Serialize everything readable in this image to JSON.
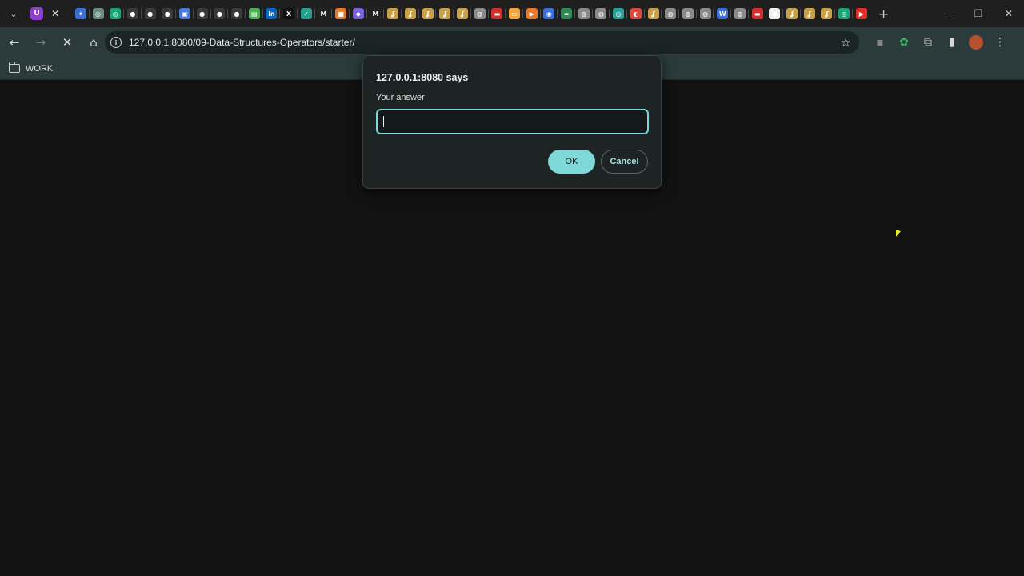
{
  "browser": {
    "url": "127.0.0.1:8080/09-Data-Structures-Operators/starter/",
    "bookmark_folder": "WORK",
    "pinned_tabs": [
      {
        "icon": "gemini-icon",
        "color": "#3b6fd8",
        "glyph": "✦"
      },
      {
        "icon": "chatgpt-icon",
        "color": "#6b8b82",
        "glyph": "◎"
      },
      {
        "icon": "chatgpt-icon",
        "color": "#19a37a",
        "glyph": "◎"
      },
      {
        "icon": "github-icon",
        "color": "#3a3a3a",
        "glyph": "●"
      },
      {
        "icon": "github-icon",
        "color": "#3a3a3a",
        "glyph": "●"
      },
      {
        "icon": "github-icon",
        "color": "#3a3a3a",
        "glyph": "●"
      },
      {
        "icon": "gallery-icon",
        "color": "#4a7ad8",
        "glyph": "▣"
      },
      {
        "icon": "github-icon",
        "color": "#3a3a3a",
        "glyph": "●"
      },
      {
        "icon": "github-icon",
        "color": "#3a3a3a",
        "glyph": "●"
      },
      {
        "icon": "github-icon",
        "color": "#3a3a3a",
        "glyph": "●"
      },
      {
        "icon": "docs-icon",
        "color": "#4caf50",
        "glyph": "▤"
      },
      {
        "icon": "linkedin-icon",
        "color": "#0a66c2",
        "glyph": "in"
      },
      {
        "icon": "x-icon",
        "color": "#111111",
        "glyph": "X"
      },
      {
        "icon": "check-icon",
        "color": "#2a9d8f",
        "glyph": "✓"
      },
      {
        "icon": "m-icon",
        "color": "#222222",
        "glyph": "M"
      },
      {
        "icon": "box-icon",
        "color": "#e8792b",
        "glyph": "■"
      },
      {
        "icon": "cube-icon",
        "color": "#7b61d8",
        "glyph": "◆"
      },
      {
        "icon": "m-icon",
        "color": "#222222",
        "glyph": "M"
      },
      {
        "icon": "brand-icon",
        "color": "#c9a04a",
        "glyph": "ʆ"
      },
      {
        "icon": "brand-icon",
        "color": "#c9a04a",
        "glyph": "ʆ"
      },
      {
        "icon": "brand-icon",
        "color": "#c9a04a",
        "glyph": "ʆ"
      },
      {
        "icon": "brand-icon",
        "color": "#c9a04a",
        "glyph": "ʆ"
      },
      {
        "icon": "brand-icon",
        "color": "#c9a04a",
        "glyph": "ʆ"
      },
      {
        "icon": "globe-icon",
        "color": "#8a8a8a",
        "glyph": "◍"
      },
      {
        "icon": "brand-red-icon",
        "color": "#d32f2f",
        "glyph": "▬"
      },
      {
        "icon": "slides-icon",
        "color": "#f2a33a",
        "glyph": "▭"
      },
      {
        "icon": "play-icon",
        "color": "#e8792b",
        "glyph": "▶"
      },
      {
        "icon": "globe-icon",
        "color": "#3b6fd8",
        "glyph": "◉"
      },
      {
        "icon": "dash-icon",
        "color": "#2e8b57",
        "glyph": "="
      },
      {
        "icon": "globe-icon",
        "color": "#8a8a8a",
        "glyph": "◍"
      },
      {
        "icon": "globe-icon",
        "color": "#8a8a8a",
        "glyph": "◍"
      },
      {
        "icon": "compass-icon",
        "color": "#2aa198",
        "glyph": "◎"
      },
      {
        "icon": "figma-icon",
        "color": "#e0473f",
        "glyph": "◐"
      },
      {
        "icon": "brand-icon",
        "color": "#c9a04a",
        "glyph": "ʆ"
      },
      {
        "icon": "globe-icon",
        "color": "#8a8a8a",
        "glyph": "◍"
      },
      {
        "icon": "globe-icon",
        "color": "#8a8a8a",
        "glyph": "◍"
      },
      {
        "icon": "globe-icon",
        "color": "#8a8a8a",
        "glyph": "◍"
      },
      {
        "icon": "wordpress-icon",
        "color": "#3b6fd8",
        "glyph": "W"
      },
      {
        "icon": "globe-icon",
        "color": "#8a8a8a",
        "glyph": "◍"
      },
      {
        "icon": "brand-red-icon",
        "color": "#d32f2f",
        "glyph": "▬"
      },
      {
        "icon": "hex-icon",
        "color": "#eeeeee",
        "glyph": "⬢"
      },
      {
        "icon": "brand-icon",
        "color": "#c9a04a",
        "glyph": "ʆ"
      },
      {
        "icon": "brand-icon",
        "color": "#c9a04a",
        "glyph": "ʆ"
      },
      {
        "icon": "brand-icon",
        "color": "#c9a04a",
        "glyph": "ʆ"
      },
      {
        "icon": "chatgpt-icon",
        "color": "#19a37a",
        "glyph": "◎"
      },
      {
        "icon": "youtube-icon",
        "color": "#e52d27",
        "glyph": "▶"
      }
    ]
  },
  "dialog": {
    "title": "127.0.0.1:8080 says",
    "message": "Your answer",
    "input_value": "",
    "ok_label": "OK",
    "cancel_label": "Cancel"
  },
  "colors": {
    "accent": "#7fd8d8",
    "toolbar": "#2b3a3a",
    "page_bg": "#121212"
  }
}
